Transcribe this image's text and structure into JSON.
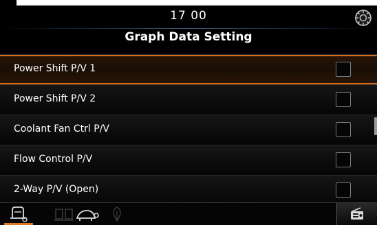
{
  "header": {
    "clock": "17 00",
    "corner_icon": "settings-gear-icon"
  },
  "page": {
    "title": "Graph Data Setting"
  },
  "items": [
    {
      "label": "Power Shift P/V 1",
      "checked": false,
      "selected": true
    },
    {
      "label": "Power Shift P/V 2",
      "checked": false,
      "selected": false
    },
    {
      "label": "Coolant Fan Ctrl P/V",
      "checked": false,
      "selected": false
    },
    {
      "label": "Flow Control P/V",
      "checked": false,
      "selected": false
    },
    {
      "label": "2-Way P/V (Open)",
      "checked": false,
      "selected": false
    }
  ],
  "bottom_tabs": [
    {
      "icon": "machine-settings-icon",
      "active": true
    },
    {
      "icon": "work-mode-icon",
      "active": false
    },
    {
      "icon": "ecology-icon",
      "active": false
    },
    {
      "icon": "tortoise-speed-icon",
      "active": false
    },
    {
      "icon": "radio-icon",
      "active": false
    }
  ],
  "colors": {
    "accent": "#e07a20",
    "background": "#000000",
    "text": "#ffffff"
  }
}
